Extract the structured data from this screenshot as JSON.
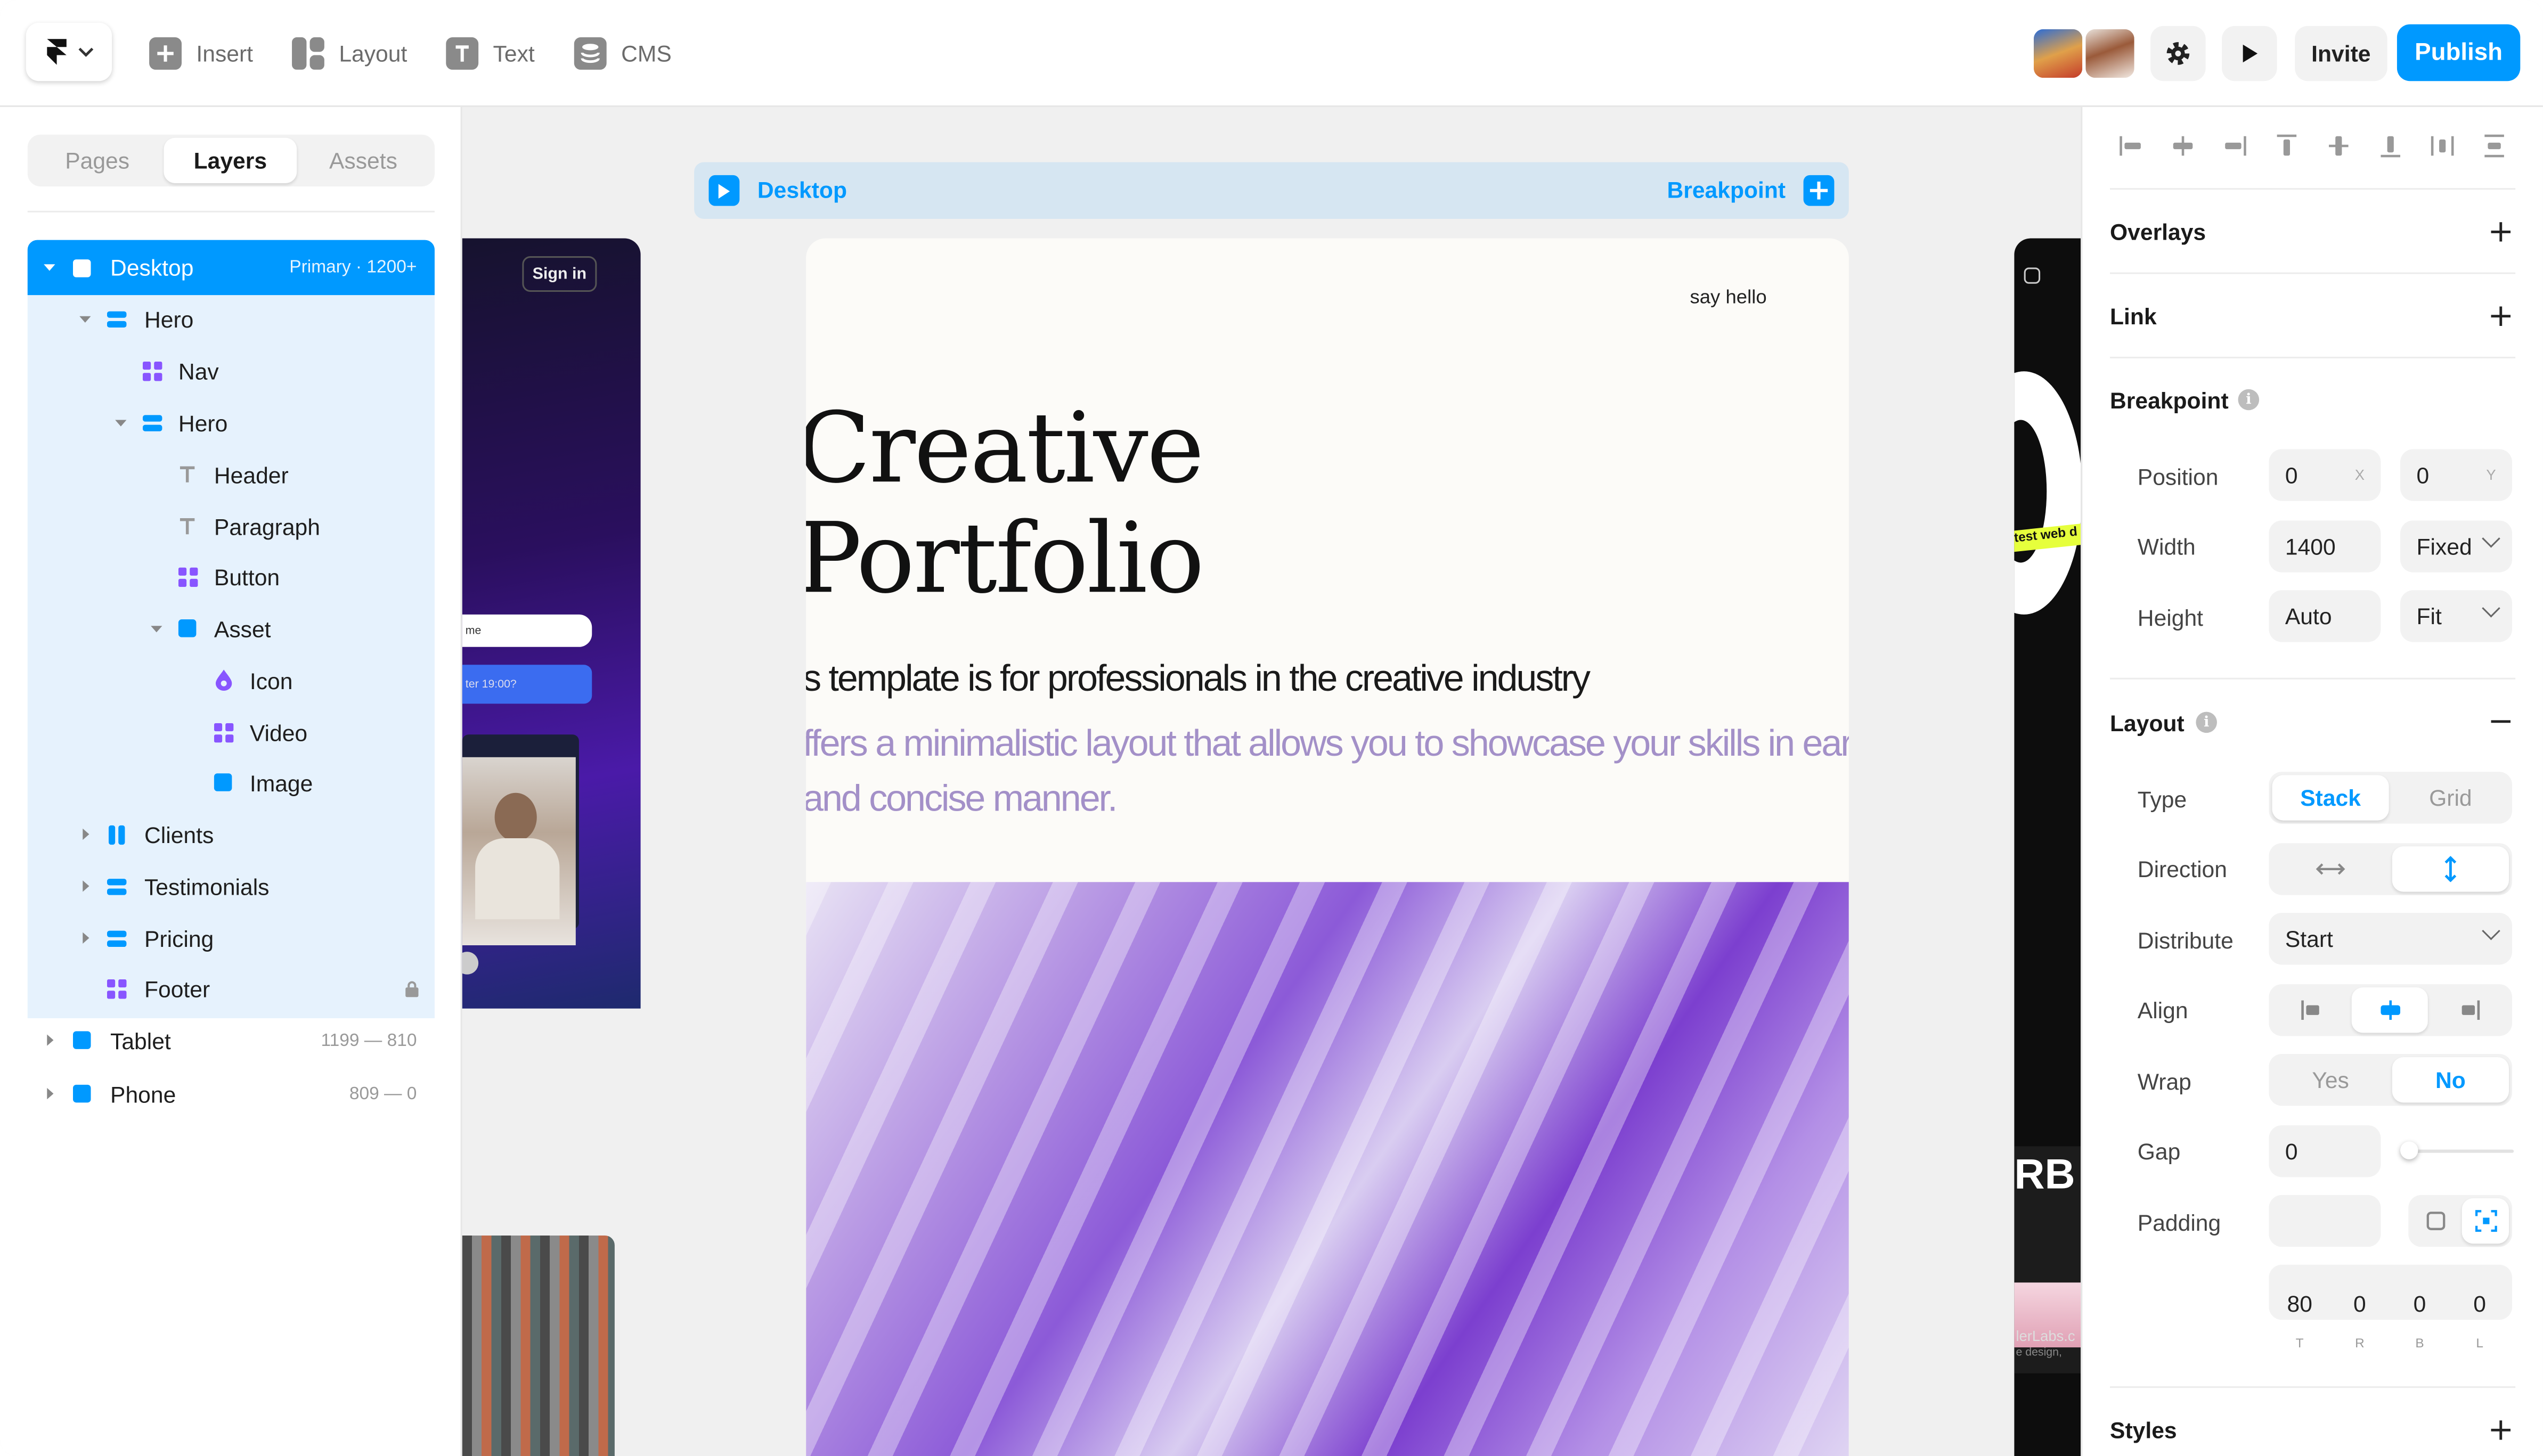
{
  "toolbar": {
    "insert": "Insert",
    "layout": "Layout",
    "text": "Text",
    "cms": "CMS",
    "invite": "Invite",
    "publish": "Publish",
    "accent": "#0099ff"
  },
  "left_panel": {
    "tabs": [
      "Pages",
      "Layers",
      "Assets"
    ],
    "active_tab": "Layers",
    "layers": [
      {
        "label": "Desktop",
        "meta": "Primary · 1200+",
        "icon": "frame-icon"
      },
      {
        "label": "Hero",
        "icon": "stack-icon"
      },
      {
        "label": "Nav",
        "icon": "component-icon"
      },
      {
        "label": "Hero",
        "icon": "stack-icon"
      },
      {
        "label": "Header",
        "icon": "text-icon"
      },
      {
        "label": "Paragraph",
        "icon": "text-icon"
      },
      {
        "label": "Button",
        "icon": "component-icon"
      },
      {
        "label": "Asset",
        "icon": "frame-icon"
      },
      {
        "label": "Icon",
        "icon": "drop-icon"
      },
      {
        "label": "Video",
        "icon": "component-icon"
      },
      {
        "label": "Image",
        "icon": "frame-icon"
      },
      {
        "label": "Clients",
        "icon": "columns-icon"
      },
      {
        "label": "Testimonials",
        "icon": "stack-icon"
      },
      {
        "label": "Pricing",
        "icon": "stack-icon"
      },
      {
        "label": "Footer",
        "icon": "component-icon"
      },
      {
        "label": "Tablet",
        "meta": "1199 — 810",
        "icon": "frame-icon"
      },
      {
        "label": "Phone",
        "meta": "809 — 0",
        "icon": "frame-icon"
      }
    ]
  },
  "canvas": {
    "breakpoint_bar": {
      "name": "Desktop",
      "action": "Breakpoint"
    },
    "left_preview": {
      "sign_in": "Sign in",
      "field": "me",
      "button": "ter 19:00?"
    },
    "frame": {
      "nav_link": "say hello",
      "title": "Creative\nPortfolio",
      "subtitle": "s template is for professionals in the creative industry",
      "description": "ffers a minimalistic layout that allows you to showcase your skills in ear and concise manner."
    },
    "right_preview": {
      "badge": "test web d",
      "big": "RB",
      "small1": "lerLabs.c",
      "small2": "e design,"
    }
  },
  "right_panel": {
    "overlays": "Overlays",
    "link": "Link",
    "breakpoint": {
      "title": "Breakpoint",
      "position_label": "Position",
      "position_x": "0",
      "position_y": "0",
      "x_suffix": "X",
      "y_suffix": "Y",
      "width_label": "Width",
      "width_value": "1400",
      "width_mode": "Fixed",
      "height_label": "Height",
      "height_value": "Auto",
      "height_mode": "Fit"
    },
    "layout": {
      "title": "Layout",
      "type_label": "Type",
      "type_options": [
        "Stack",
        "Grid"
      ],
      "type_selected": "Stack",
      "direction_label": "Direction",
      "distribute_label": "Distribute",
      "distribute_value": "Start",
      "align_label": "Align",
      "wrap_label": "Wrap",
      "wrap_options": [
        "Yes",
        "No"
      ],
      "wrap_selected": "No",
      "gap_label": "Gap",
      "gap_value": "0",
      "padding_label": "Padding",
      "padding_values": [
        "80",
        "0",
        "0",
        "0"
      ],
      "padding_sides": [
        "T",
        "R",
        "B",
        "L"
      ]
    },
    "styles": "Styles"
  }
}
